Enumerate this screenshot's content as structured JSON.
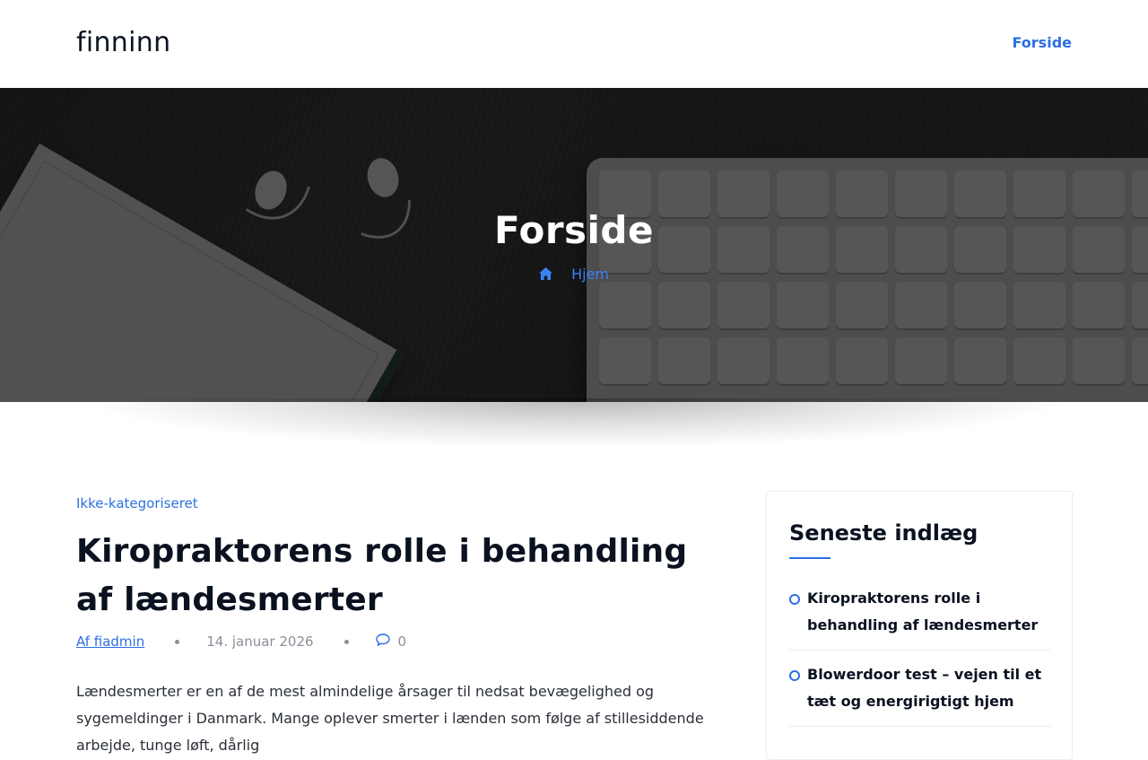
{
  "header": {
    "site_title": "finninn",
    "nav": [
      {
        "label": "Forside"
      }
    ]
  },
  "hero": {
    "title": "Forside",
    "breadcrumb": {
      "home_icon": "home-icon",
      "label": "Hjem"
    }
  },
  "article": {
    "category": "Ikke-kategoriseret",
    "title": "Kiropraktorens rolle i behandling af lændesmerter",
    "author": "Af fiadmin",
    "date": "14. januar 2026",
    "comment_icon": "comment-icon",
    "comments": "0",
    "excerpt": "Lændesmerter er en af de mest almindelige årsager til nedsat bevægelighed og sygemeldinger i Danmark. Mange oplever smerter i lænden som følge af stillesiddende arbejde, tunge løft, dårlig"
  },
  "sidebar": {
    "widget_title": "Seneste indlæg",
    "recent_posts": [
      {
        "title": "Kiropraktorens rolle i behandling af lændesmerter"
      },
      {
        "title": "Blowerdoor test – vejen til et tæt og energirigtigt hjem"
      }
    ]
  },
  "colors": {
    "accent": "#2d6fe0",
    "text": "#0a1220",
    "muted": "#8a8f98"
  }
}
